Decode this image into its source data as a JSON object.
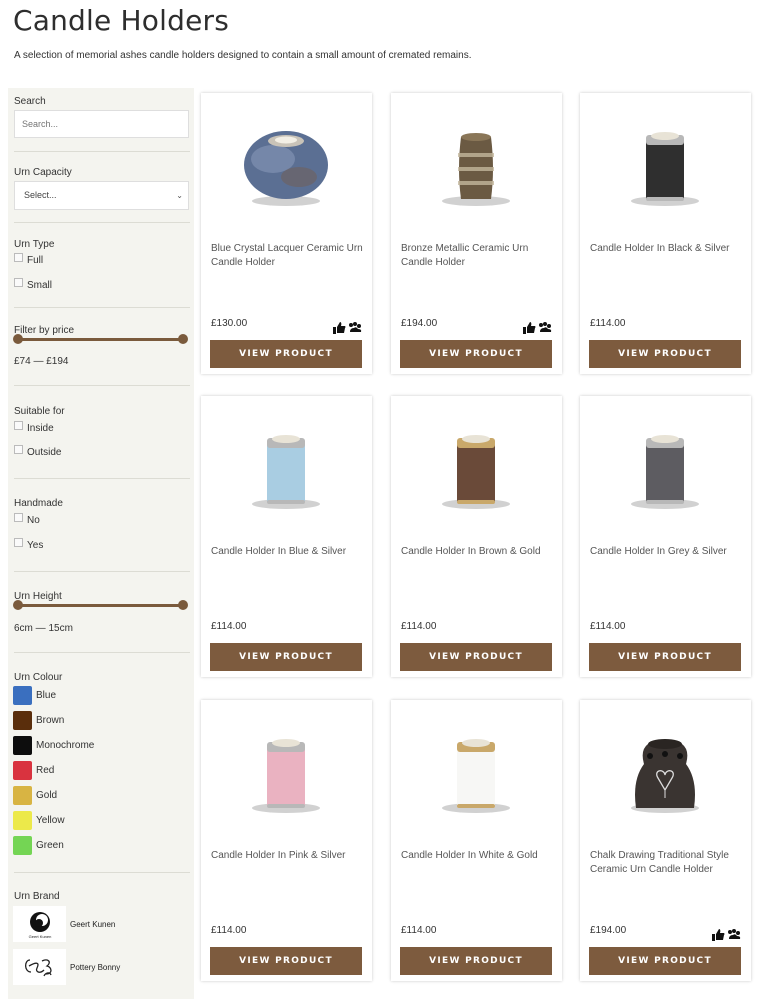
{
  "page": {
    "title": "Candle Holders",
    "description": "A selection of memorial ashes candle holders designed to contain a small amount of cremated remains."
  },
  "sidebar": {
    "search": {
      "label": "Search",
      "placeholder": "Search..."
    },
    "capacity": {
      "label": "Urn Capacity",
      "selected": "Select..."
    },
    "type": {
      "label": "Urn Type",
      "options": [
        "Full",
        "Small"
      ]
    },
    "price": {
      "label": "Filter by price",
      "range": "£74 — £194",
      "min_fraction": 0,
      "max_fraction": 1
    },
    "suitable": {
      "label": "Suitable for",
      "options": [
        "Inside",
        "Outside"
      ]
    },
    "handmade": {
      "label": "Handmade",
      "options": [
        "No",
        "Yes"
      ]
    },
    "height": {
      "label": "Urn Height",
      "range": "6cm — 15cm",
      "min_fraction": 0,
      "max_fraction": 1
    },
    "colour": {
      "label": "Urn Colour",
      "options": [
        {
          "name": "Blue",
          "color": "#3a6fbf"
        },
        {
          "name": "Brown",
          "color": "#5a2e0c"
        },
        {
          "name": "Monochrome",
          "color": "#0d0d0d"
        },
        {
          "name": "Red",
          "color": "#d9333f"
        },
        {
          "name": "Gold",
          "color": "#d8b443"
        },
        {
          "name": "Yellow",
          "color": "#ece94a"
        },
        {
          "name": "Green",
          "color": "#74d554"
        }
      ]
    },
    "brand": {
      "label": "Urn Brand",
      "options": [
        {
          "name": "Geert Kunen",
          "logo_text": "Geert Kunen"
        },
        {
          "name": "Pottery Bonny",
          "logo_text": ""
        }
      ]
    }
  },
  "products": [
    {
      "name": "Blue Crystal Lacquer Ceramic Urn Candle Holder",
      "price": "£130.00",
      "button": "VIEW PRODUCT",
      "eco_icons": true,
      "shape": "round",
      "color": "#5b6f93"
    },
    {
      "name": "Bronze Metallic Ceramic Urn Candle Holder",
      "price": "£194.00",
      "button": "VIEW PRODUCT",
      "eco_icons": true,
      "shape": "barrel",
      "color": "#6b5a43"
    },
    {
      "name": "Candle Holder In Black & Silver",
      "price": "£114.00",
      "button": "VIEW PRODUCT",
      "eco_icons": false,
      "shape": "cylinder",
      "color": "#2f2f2f"
    },
    {
      "name": "Candle Holder In Blue & Silver",
      "price": "£114.00",
      "button": "VIEW PRODUCT",
      "eco_icons": false,
      "shape": "cylinder",
      "color": "#a9cde2"
    },
    {
      "name": "Candle Holder In Brown & Gold",
      "price": "£114.00",
      "button": "VIEW PRODUCT",
      "eco_icons": false,
      "shape": "cylinder",
      "color": "#6a4a39"
    },
    {
      "name": "Candle Holder In Grey & Silver",
      "price": "£114.00",
      "button": "VIEW PRODUCT",
      "eco_icons": false,
      "shape": "cylinder",
      "color": "#5d5c61"
    },
    {
      "name": "Candle Holder In Pink & Silver",
      "price": "£114.00",
      "button": "VIEW PRODUCT",
      "eco_icons": false,
      "shape": "cylinder",
      "color": "#eab2c1"
    },
    {
      "name": "Candle Holder In White & Gold",
      "price": "£114.00",
      "button": "VIEW PRODUCT",
      "eco_icons": false,
      "shape": "cylinder",
      "color": "#f7f7f5"
    },
    {
      "name": "Chalk Drawing Traditional Style Ceramic Urn Candle Holder",
      "price": "£194.00",
      "button": "VIEW PRODUCT",
      "eco_icons": true,
      "shape": "chalk",
      "color": "#3a3431"
    }
  ]
}
